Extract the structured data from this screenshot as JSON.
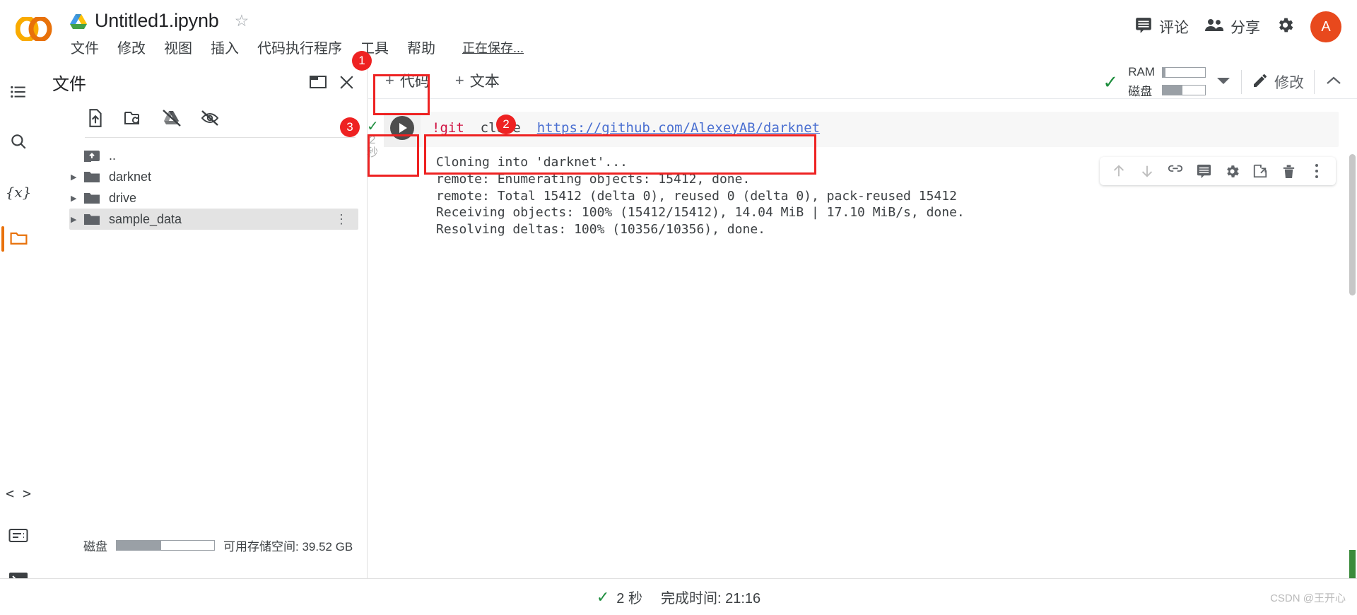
{
  "header": {
    "doc_title": "Untitled1.ipynb",
    "star_icon": "star-outline-icon",
    "drive_icon": "google-drive-icon",
    "logo": "colab-logo",
    "menus": [
      "文件",
      "修改",
      "视图",
      "插入",
      "代码执行程序",
      "工具",
      "帮助"
    ],
    "saving_status": "正在保存...",
    "comment_label": "评论",
    "comment_icon": "comment-icon",
    "share_label": "分享",
    "share_icon": "people-icon",
    "settings_icon": "gear-icon",
    "avatar_initial": "A",
    "avatar_color": "#e8491d"
  },
  "rail": {
    "items": [
      {
        "name": "toc-icon",
        "label": "目录"
      },
      {
        "name": "search-icon",
        "label": "搜索"
      },
      {
        "name": "variables-icon",
        "label": "{x}"
      },
      {
        "name": "files-folder-icon",
        "label": "文件",
        "active": true
      },
      {
        "name": "code-snippets-icon",
        "label": "<>"
      },
      {
        "name": "command-palette-icon",
        "label": "命令面板"
      },
      {
        "name": "terminal-icon",
        "label": "终端"
      }
    ]
  },
  "files_panel": {
    "title": "文件",
    "header_icons": [
      "open-new-window-icon",
      "close-icon"
    ],
    "toolbar_icons": [
      "upload-file-icon",
      "refresh-folder-icon",
      "mount-drive-off-icon",
      "hide-hidden-files-icon"
    ],
    "tree": [
      {
        "label": "..",
        "icon": "parent-folder-icon",
        "caret": false,
        "selected": false
      },
      {
        "label": "darknet",
        "icon": "folder-icon",
        "caret": true,
        "selected": false
      },
      {
        "label": "drive",
        "icon": "folder-icon",
        "caret": true,
        "selected": false
      },
      {
        "label": "sample_data",
        "icon": "folder-icon",
        "caret": true,
        "selected": true,
        "more": "⋮"
      }
    ],
    "disk_label": "磁盘",
    "disk_fill_percent": 46,
    "disk_free_text": "可用存储空间: 39.52 GB"
  },
  "notebook": {
    "add_code_label": "代码",
    "add_text_label": "文本",
    "plus": "+",
    "connection": {
      "status_icon": "check-icon",
      "ram_label": "RAM",
      "ram_fill_percent": 6,
      "disk_label": "磁盘",
      "disk_fill_percent": 46,
      "dropdown_icon": "chevron-down-icon",
      "edit_icon": "pencil-icon",
      "edit_label": "修改",
      "collapse_icon": "chevron-up-icon"
    },
    "cell": {
      "run_icon": "run-play-icon",
      "status_check": "✓",
      "exec_time": "2\n秒",
      "exec_time_value": "2",
      "exec_time_unit": "秒",
      "code_prefix": "!git",
      "code_command": "  clone  ",
      "code_url": "https://github.com/AlexeyAB/darknet",
      "output_lines": [
        "Cloning into 'darknet'...",
        "remote: Enumerating objects: 15412, done.",
        "remote: Total 15412 (delta 0), reused 0 (delta 0), pack-reused 15412",
        "Receiving objects: 100% (15412/15412), 14.04 MiB | 17.10 MiB/s, done.",
        "Resolving deltas: 100% (10356/10356), done."
      ]
    },
    "cell_toolbar_icons": [
      "move-cell-up-icon",
      "move-cell-down-icon",
      "link-icon",
      "comment-icon",
      "cell-settings-icon",
      "open-in-tab-icon",
      "delete-cell-icon",
      "more-options-icon"
    ]
  },
  "statusbar": {
    "check_icon": "check-icon",
    "duration": "2 秒",
    "finish_text": "完成时间: 21:16",
    "watermark": "CSDN @王开心"
  },
  "annotations": [
    {
      "num": "1",
      "target": "tools-menu"
    },
    {
      "num": "2",
      "target": "code-cell-source"
    },
    {
      "num": "3",
      "target": "run-cell-gutter"
    }
  ]
}
